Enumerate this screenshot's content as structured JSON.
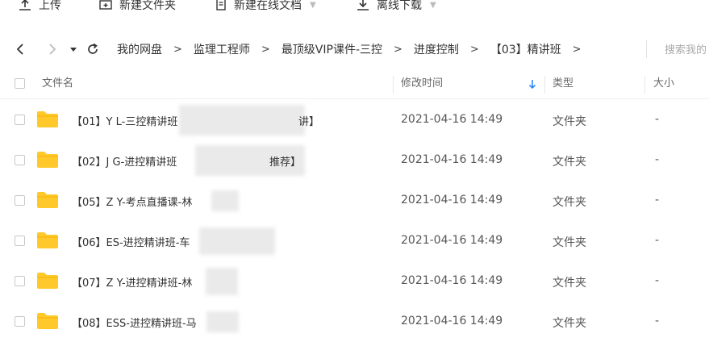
{
  "toolbar": {
    "upload_label": "上传",
    "new_folder_label": "新建文件夹",
    "new_doc_label": "新建在线文档",
    "offline_download_label": "离线下载"
  },
  "breadcrumb": [
    "我的网盘",
    "监理工程师",
    "最顶级VIP课件-三控",
    "进度控制",
    "【03】精讲班"
  ],
  "search": {
    "placeholder": "搜索我的"
  },
  "columns": {
    "name": "文件名",
    "modified": "修改时间",
    "type": "类型",
    "size": "大小"
  },
  "files": [
    {
      "name": "【01】Y  L-三控精讲班",
      "tail": "讲】",
      "modified": "2021-04-16 14:49",
      "type": "文件夹",
      "size": "-"
    },
    {
      "name": "【02】J  G-进控精讲班",
      "tail": "推荐】",
      "modified": "2021-04-16 14:49",
      "type": "文件夹",
      "size": "-"
    },
    {
      "name": "【05】Z  Y-考点直播课-林",
      "tail": "",
      "modified": "2021-04-16 14:49",
      "type": "文件夹",
      "size": "-"
    },
    {
      "name": "【06】ES-进控精讲班-车",
      "tail": "",
      "modified": "2021-04-16 14:49",
      "type": "文件夹",
      "size": "-"
    },
    {
      "name": "【07】Z Y-进控精讲班-林",
      "tail": "",
      "modified": "2021-04-16 14:49",
      "type": "文件夹",
      "size": "-"
    },
    {
      "name": "【08】ESS-进控精讲班-马",
      "tail": "",
      "modified": "2021-04-16 14:49",
      "type": "文件夹",
      "size": "-"
    }
  ],
  "colors": {
    "folder": "#ffc92b",
    "sort_arrow": "#2b8af7"
  }
}
